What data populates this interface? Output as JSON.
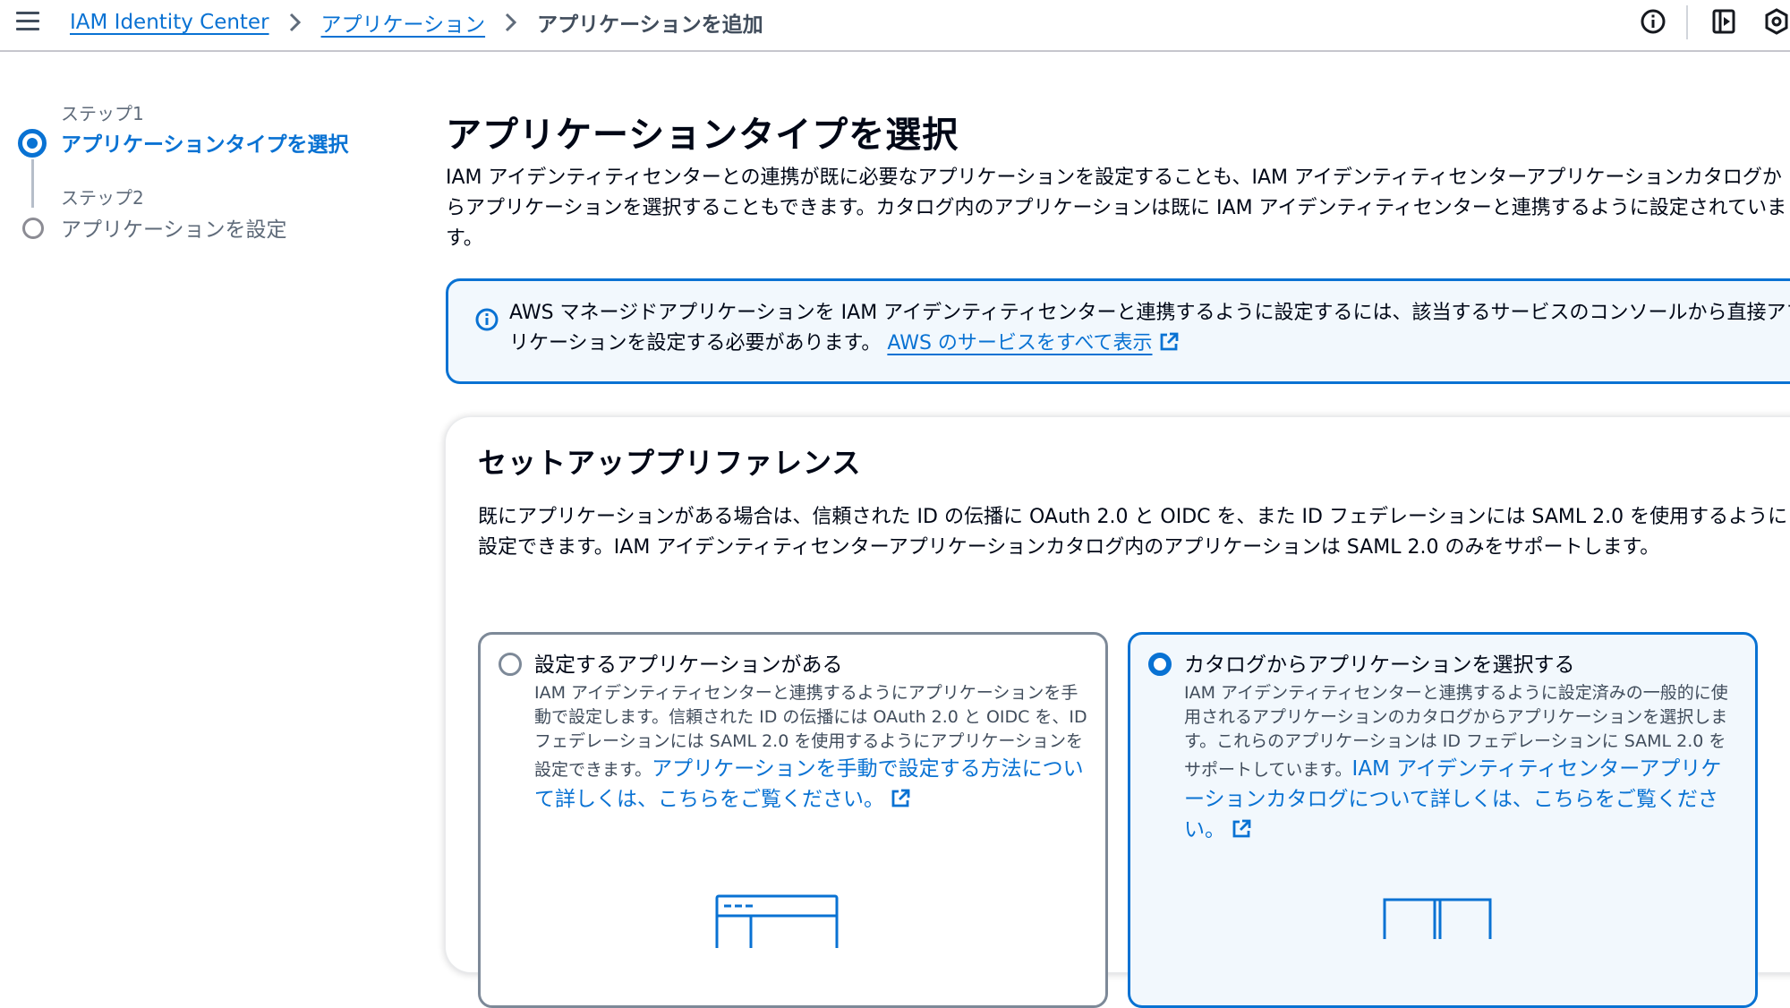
{
  "header": {
    "breadcrumbs": [
      {
        "label": "IAM Identity Center"
      },
      {
        "label": "アプリケーション"
      },
      {
        "label": "アプリケーションを追加"
      }
    ],
    "icons": [
      "menu-icon",
      "info-icon",
      "panel-icon",
      "settings-icon"
    ]
  },
  "wizard": {
    "steps": [
      {
        "step_label": "ステップ1",
        "title": "アプリケーションタイプを選択",
        "state": "active"
      },
      {
        "step_label": "ステップ2",
        "title": "アプリケーションを設定",
        "state": "inactive"
      }
    ]
  },
  "main": {
    "title": "アプリケーションタイプを選択",
    "description": "IAM アイデンティティセンターとの連携が既に必要なアプリケーションを設定することも、IAM アイデンティティセンターアプリケーションカタログからアプリケーションを選択することもできます。カタログ内のアプリケーションは既に IAM アイデンティティセンターと連携するように設定されています。",
    "info_alert": {
      "text": "AWS マネージドアプリケーションを IAM アイデンティティセンターと連携するように設定するには、該当するサービスのコンソールから直接アプリケーションを設定する必要があります。",
      "link": "AWS のサービスをすべて表示"
    },
    "setup": {
      "title": "セットアッププリファレンス",
      "description": "既にアプリケーションがある場合は、信頼された ID の伝播に OAuth 2.0 と OIDC を、また ID フェデレーションには SAML 2.0 を使用するように設定できます。IAM アイデンティティセンターアプリケーションカタログ内のアプリケーションは SAML 2.0 のみをサポートします。",
      "options": [
        {
          "label": "設定するアプリケーションがある",
          "description": "IAM アイデンティティセンターと連携するようにアプリケーションを手動で設定します。信頼された ID の伝播には OAuth 2.0 と OIDC を、ID フェデレーションには SAML 2.0 を使用するようにアプリケーションを設定できます。",
          "link": "アプリケーションを手動で設定する方法について詳しくは、こちらをご覧ください。",
          "selected": false
        },
        {
          "label": "カタログからアプリケーションを選択する",
          "description": "IAM アイデンティティセンターと連携するように設定済みの一般的に使用されるアプリケーションのカタログからアプリケーションを選択します。これらのアプリケーションは ID フェデレーションに SAML 2.0 をサポートしています。",
          "link": "IAM アイデンティティセンターアプリケーションカタログについて詳しくは、こちらをご覧ください。",
          "selected": true
        }
      ]
    }
  },
  "colors": {
    "accent": "#0972d3",
    "text": "#000716",
    "secondary_text": "#5f6b7a",
    "alert_background": "#f2f8fd",
    "border": "#7d8998"
  }
}
